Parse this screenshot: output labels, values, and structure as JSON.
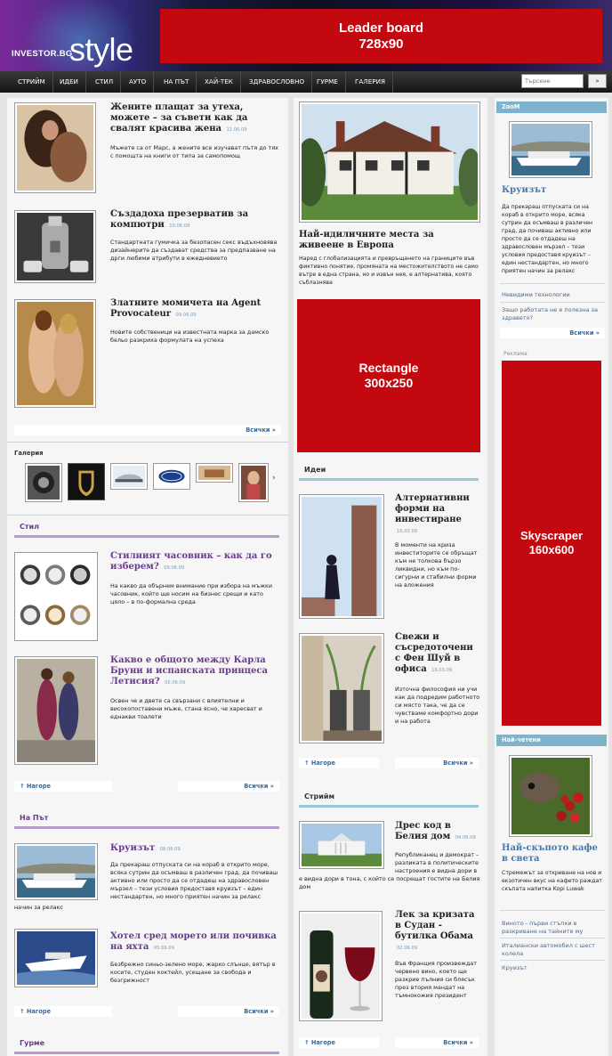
{
  "header": {
    "logo_small": "INVESTOR.BG",
    "logo_big": "style",
    "leader_line1": "Leader board",
    "leader_line2": "728x90"
  },
  "nav": {
    "items": [
      "СТРИЙМ",
      "ИДЕИ",
      "СТИЛ",
      "АУТО",
      "НА ПЪТ",
      "ХАЙ-ТЕК",
      "ЗДРАВОСЛОВНО",
      "ГУРМЕ",
      "ГАЛЕРИЯ"
    ],
    "search_placeholder": "Търсене",
    "search_button": "»"
  },
  "colors": {
    "ad_red": "#c4080f",
    "link_blue": "#4a78a8",
    "purple": "#6a3b8c",
    "side_header": "#7fb2cc"
  },
  "left": {
    "top_articles": [
      {
        "title": "Жените плащат за утеха, можете – за съвети как да свалят красива жена",
        "date": "11.06.09",
        "text": "Мъжете са от Марс, а жените все изучават пътя до тях с помощта на книги от типа за самопомощ"
      },
      {
        "title": "Създадоха презерватив за компютри",
        "date": "10.06.09",
        "text": "Стандартната гумичка за безопасен секс въдъхновява дизайнерите да създават средства за предпазване на дрги любими атрибути в ежедневието"
      },
      {
        "title": "Златните момичета на Agent Provocateur",
        "date": "09.06.09",
        "text": "Новите собственици на известната марка за дамско бельо разкриха формулата на успеха"
      }
    ],
    "top_more": "Всички »",
    "gallery_label": "Галерия",
    "gallery_arrow": "›",
    "style": {
      "title": "Стил",
      "articles": [
        {
          "title": "Стилният часовник – как да го изберем?",
          "date": "09.06.09",
          "text": "На какво да обърнем внимание при избора на мъжки часовник, който ще носим на бизнес срещи и като цяло – в по-формална среда"
        },
        {
          "title": "Какво е общото между Карла Бруни и испанската принцеса Летисия?",
          "date": "05.06.09",
          "text": "Освен че и двете са свързани с влиятелни и високопоставени мъже, стана ясно, че харесват и еднакви тоалети"
        }
      ],
      "top": "↑ Нагоре",
      "more": "Всички »"
    },
    "road": {
      "title": "На Път",
      "articles": [
        {
          "title": "Круизът",
          "date": "08.06.09",
          "text": "Да прекараш отпуската си на кораб в открито море, всяка сутрин да осъмваш в различен град, да почиваш активно или просто да се отдадеш на здравословен мързел – тези условия предоставя круизът – един нестандартен, но много приятен начин за релакс"
        },
        {
          "title": "Хотел сред морето или почивка на яхта",
          "date": "05.06.09",
          "text": "Безбрежно синьо-зелено море, жарко слънце, вятър в косите, студен коктейл, усещане за свобода и безгрижност"
        }
      ],
      "top": "↑ Нагоре",
      "more": "Всички »"
    },
    "gourmet_title": "Гурме"
  },
  "middle": {
    "feature": {
      "title": "Най-идиличните места за живеене в Европа",
      "text": "Наред с глобализацията и превръщането на границите във фиктивно понятие, промяната на местожителството не само вътре в една страна, но и извън нея, е алтернатива, която съблазнява"
    },
    "rect_line1": "Rectangle",
    "rect_line2": "300x250",
    "ideas": {
      "title": "Идеи",
      "articles": [
        {
          "title": "Алтернативни форми на инвестиране",
          "date": "16.03.09",
          "text": "В моменти на криза инвеститорите се обръщат към не толкова бързо ликвидни, но към по-сигурни и стабилни форми на вложения"
        },
        {
          "title": "Свежи и съсредоточени с Фен Шуй в офиса",
          "date": "16.03.09",
          "text": "Източна философия ни учи как да подредим работното си място така, че да се чувстваме комфортно дори и на работа"
        }
      ],
      "top": "↑ Нагоре",
      "more": "Всички »"
    },
    "stream": {
      "title": "Стрийм",
      "articles": [
        {
          "title": "Дрес код в Белия дом",
          "date": "04.06.09",
          "text": "Републиканец и демократ – разликата в политическите настроения е видна дори в тона, с който се посрещат гостите на Белия дом"
        },
        {
          "title": "Лек за кризата в Судан - бутилка Обама",
          "date": "02.06.09",
          "text": "Във Франция произвеждат червено вино, което ще разкрие пълния си блясък през втория мандат на тъмнокожия президент"
        }
      ],
      "top": "↑ Нагоре",
      "more": "Всички »"
    }
  },
  "right": {
    "zoom": {
      "header": "ZooM",
      "title": "Круизът",
      "text": "Да прекараш отпуската си на кораб в открито море, всяка сутрин да осъмваш в различен град, да почиваш активно или просто да се отдадеш на здравословен мързел – тези условия предоставя круизът – един нестандартен, но много приятен начин за релакс",
      "links": [
        "Невидими технологии",
        "Защо работата не е полезна за здравето?"
      ],
      "more": "Всички »"
    },
    "ad_label": "Реклама",
    "sky_line1": "Skyscraper",
    "sky_line2": "160x600",
    "most_read": {
      "header": "Най-четени",
      "title": "Най-скъпото кафе в света",
      "text": "Стремежът за откриване на нов и екзотичен вкус на кафето раждат скъпата напитка Kopi Luwak",
      "links": [
        "Виното - първи стъпки в разкриване на тайните му",
        "Италиански автомобил с шест колела",
        "Круизът"
      ]
    }
  }
}
